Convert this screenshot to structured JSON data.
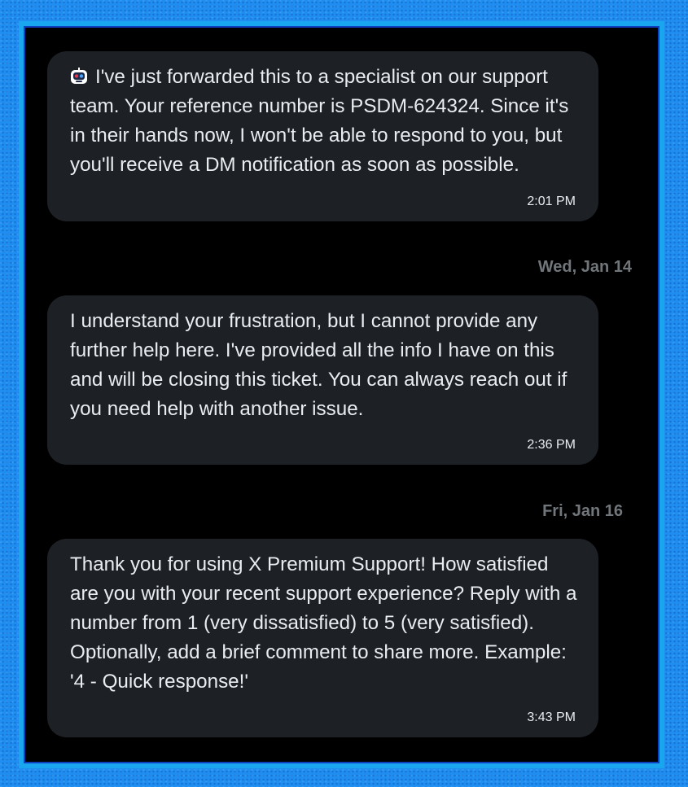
{
  "messages": [
    {
      "text": "I've just forwarded this to a specialist on our support team. Your reference number is PSDM-624324. Since it's in their hands now, I won't be able to respond to you, but you'll receive a DM notification as soon as possible.",
      "time": "2:01 PM",
      "icon": "robot-icon"
    },
    {
      "text": "I understand your frustration, but I cannot provide any further help here. I've provided all the info I have on this and will be closing this ticket. You can always reach out if you need help with another issue.",
      "time": "2:36 PM"
    },
    {
      "text": "Thank you for using X Premium Support! How satisfied are you with your recent support experience? Reply with a number from 1 (very dissatisfied) to 5 (very satisfied). Optionally, add a brief comment to share more. Example: '4 - Quick response!'",
      "time": "3:43 PM"
    }
  ],
  "dates": [
    "Wed, Jan 14",
    "Fri, Jan 16"
  ],
  "colors": {
    "outer_background": "#1f8ef0",
    "frame_border": "#1aa6ee",
    "chat_background": "#000000",
    "bubble_background": "#1d2125",
    "message_text": "#e9edf0",
    "date_text": "#71767b"
  }
}
